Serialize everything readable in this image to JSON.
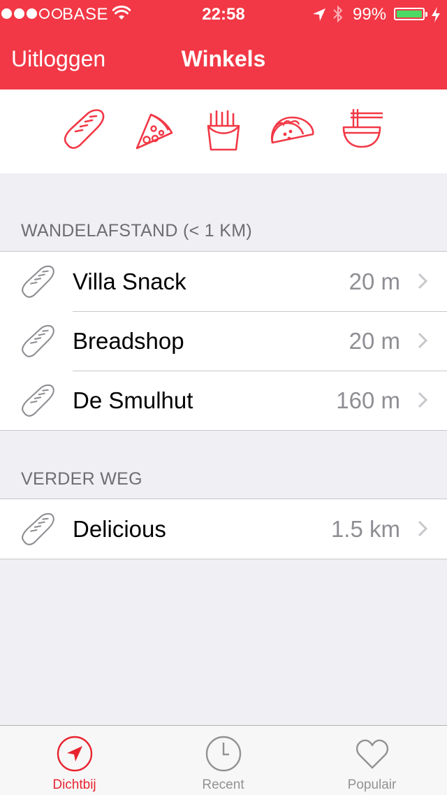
{
  "status_bar": {
    "signal_dots_filled": 3,
    "signal_dots_total": 5,
    "carrier": "BASE",
    "time": "22:58",
    "battery_percent": "99%",
    "battery_level": 0.99,
    "icons": [
      "wifi-icon",
      "location-arrow-icon",
      "bluetooth-icon",
      "battery-icon",
      "charging-bolt-icon"
    ]
  },
  "nav": {
    "left_button": "Uitloggen",
    "title": "Winkels"
  },
  "categories": [
    {
      "icon": "bread-icon"
    },
    {
      "icon": "pizza-icon"
    },
    {
      "icon": "fries-icon"
    },
    {
      "icon": "taco-icon"
    },
    {
      "icon": "noodle-bowl-icon"
    }
  ],
  "sections": [
    {
      "header": "WANDELAFSTAND (< 1 KM)",
      "rows": [
        {
          "name": "Villa Snack",
          "distance": "20 m",
          "icon": "bread-icon"
        },
        {
          "name": "Breadshop",
          "distance": "20 m",
          "icon": "bread-icon"
        },
        {
          "name": "De Smulhut",
          "distance": "160 m",
          "icon": "bread-icon"
        }
      ]
    },
    {
      "header": "VERDER WEG",
      "rows": [
        {
          "name": "Delicious",
          "distance": "1.5 km",
          "icon": "bread-icon"
        }
      ]
    }
  ],
  "tabs": [
    {
      "label": "Dichtbij",
      "icon": "location-arrow-icon",
      "active": true
    },
    {
      "label": "Recent",
      "icon": "clock-icon",
      "active": false
    },
    {
      "label": "Populair",
      "icon": "heart-icon",
      "active": false
    }
  ],
  "colors": {
    "brand_red": "#f23846",
    "active_tab": "#e8232f",
    "inactive_gray": "#929292",
    "background": "#efeff4",
    "battery_green": "#4cd964"
  }
}
